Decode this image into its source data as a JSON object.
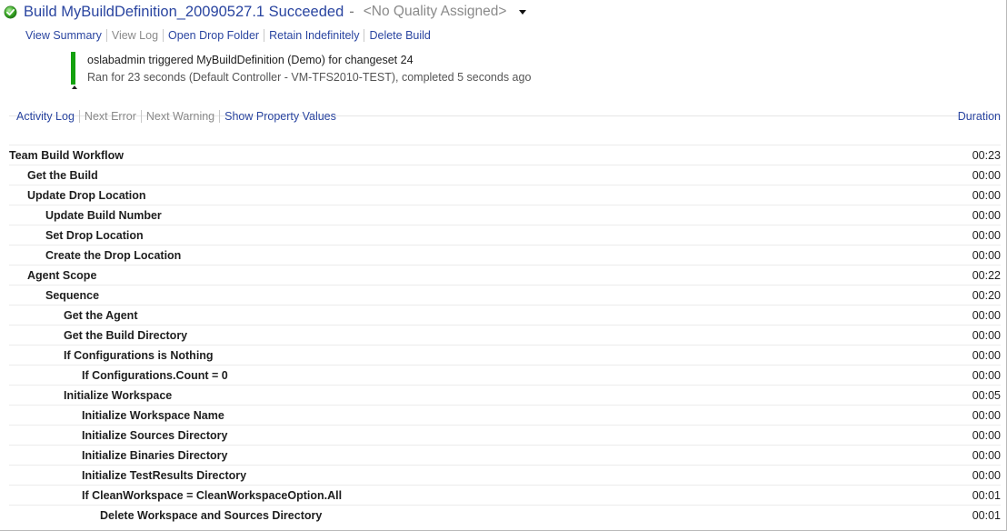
{
  "build": {
    "status_icon": "success-check-icon",
    "status_color": "#13a10e",
    "title": "Build MyBuildDefinition_20090527.1 Succeeded",
    "separator": "-",
    "quality": "<No Quality Assigned>"
  },
  "actions": [
    {
      "label": "View Summary",
      "enabled": true
    },
    {
      "label": "View Log",
      "enabled": false
    },
    {
      "label": "Open Drop Folder",
      "enabled": true
    },
    {
      "label": "Retain Indefinitely",
      "enabled": true
    },
    {
      "label": "Delete Build",
      "enabled": true
    }
  ],
  "summary": {
    "line1": "oslabadmin triggered MyBuildDefinition (Demo) for changeset 24",
    "line2": "Ran for 23 seconds (Default Controller - VM-TFS2010-TEST), completed 5 seconds ago"
  },
  "log_toolbar": [
    {
      "label": "Activity Log",
      "enabled": true
    },
    {
      "label": "Next Error",
      "enabled": false
    },
    {
      "label": "Next Warning",
      "enabled": false
    },
    {
      "label": "Show Property Values",
      "enabled": true
    }
  ],
  "duration_header": "Duration",
  "activities": [
    {
      "level": 0,
      "name": "Team Build Workflow",
      "duration": "00:23"
    },
    {
      "level": 1,
      "name": "Get the Build",
      "duration": "00:00"
    },
    {
      "level": 1,
      "name": "Update Drop Location",
      "duration": "00:00"
    },
    {
      "level": 2,
      "name": "Update Build Number",
      "duration": "00:00"
    },
    {
      "level": 2,
      "name": "Set Drop Location",
      "duration": "00:00"
    },
    {
      "level": 2,
      "name": "Create the Drop Location",
      "duration": "00:00"
    },
    {
      "level": 1,
      "name": "Agent Scope",
      "duration": "00:22"
    },
    {
      "level": 2,
      "name": "Sequence",
      "duration": "00:20"
    },
    {
      "level": 3,
      "name": "Get the Agent",
      "duration": "00:00"
    },
    {
      "level": 3,
      "name": "Get the Build Directory",
      "duration": "00:00"
    },
    {
      "level": 3,
      "name": "If Configurations is Nothing",
      "duration": "00:00"
    },
    {
      "level": 4,
      "name": "If Configurations.Count = 0",
      "duration": "00:00"
    },
    {
      "level": 3,
      "name": "Initialize Workspace",
      "duration": "00:05"
    },
    {
      "level": 4,
      "name": "Initialize Workspace Name",
      "duration": "00:00"
    },
    {
      "level": 4,
      "name": "Initialize Sources Directory",
      "duration": "00:00"
    },
    {
      "level": 4,
      "name": "Initialize Binaries Directory",
      "duration": "00:00"
    },
    {
      "level": 4,
      "name": "Initialize TestResults Directory",
      "duration": "00:00"
    },
    {
      "level": 4,
      "name": "If CleanWorkspace = CleanWorkspaceOption.All",
      "duration": "00:01"
    },
    {
      "level": 5,
      "name": "Delete Workspace and Sources Directory",
      "duration": "00:01"
    }
  ]
}
